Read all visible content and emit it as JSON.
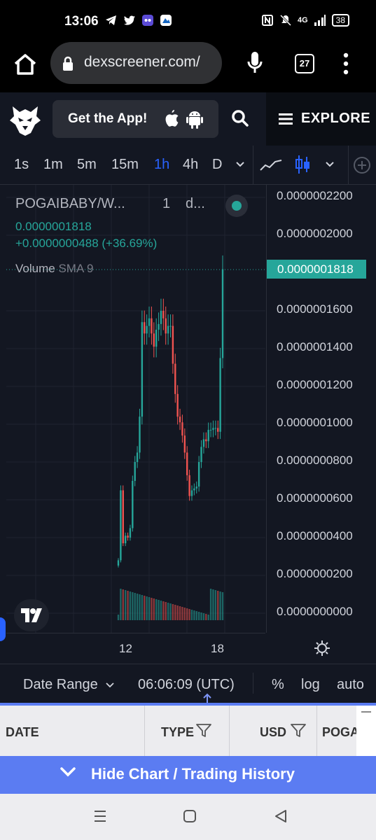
{
  "status_bar": {
    "time": "13:06",
    "network": "4G",
    "battery": "38"
  },
  "browser": {
    "url": "dexscreener.com/",
    "tab_count": "27"
  },
  "dex_header": {
    "get_app_label": "Get the App!",
    "explore_label": "EXPLORE"
  },
  "chart_toolbar": {
    "timeframes": [
      "1s",
      "1m",
      "5m",
      "15m",
      "1h",
      "4h",
      "D"
    ],
    "active_timeframe": "1h"
  },
  "legend": {
    "symbol": "POGAIBABY/W...",
    "interval": "1",
    "source": "d...",
    "price": "0.0000001818",
    "change": "+0.0000000488 (+36.69%)",
    "volume_label": "Volume",
    "volume_sma": "SMA 9"
  },
  "price_axis": {
    "ticks": [
      "0.0000002200",
      "0.0000002000",
      "0.0000001600",
      "0.0000001400",
      "0.0000001200",
      "0.0000001000",
      "0.0000000800",
      "0.0000000600",
      "0.0000000400",
      "0.0000000200",
      "0.0000000000"
    ],
    "last_price": "0.0000001818"
  },
  "time_axis": {
    "ticks": [
      "12",
      "18"
    ]
  },
  "bottom_bar": {
    "date_range": "Date Range",
    "clock": "06:06:09 (UTC)",
    "percent": "%",
    "log": "log",
    "auto": "auto"
  },
  "table_header": {
    "columns": [
      "DATE",
      "TYPE",
      "USD",
      "POGA"
    ]
  },
  "hide_chart_label": "Hide Chart / Trading History",
  "colors": {
    "up": "#26a69a",
    "down": "#ef5350",
    "accent": "#2962ff",
    "banner": "#5b7cf2"
  },
  "chart_data": {
    "type": "candlestick",
    "x_ticks": [
      "12",
      "18"
    ],
    "y_ticks": [
      2.2e-07,
      2e-07,
      1.6e-07,
      1.4e-07,
      1.2e-07,
      1e-07,
      8e-08,
      6e-08,
      4e-08,
      2e-08,
      0
    ],
    "ylim": [
      0,
      2.275e-07
    ],
    "last": 1.818e-07,
    "grid": true,
    "close_series": [
      2.8e-08,
      6.5e-08,
      3.7e-08,
      4.1e-08,
      4e-08,
      4.5e-08,
      7e-08,
      8e-08,
      8.5e-08,
      1.04e-07,
      1.54e-07,
      1.48e-07,
      1.52e-07,
      1.56e-07,
      1.48e-07,
      1.41e-07,
      1.5e-07,
      1.53e-07,
      1.6e-07,
      1.56e-07,
      1.48e-07,
      1.52e-07,
      1.52e-07,
      1.32e-07,
      1.16e-07,
      1.04e-07,
      1.01e-07,
      9.4e-08,
      8.5e-08,
      7.3e-08,
      6.2e-08,
      6.5e-08,
      6.6e-08,
      6.7e-08,
      8e-08,
      8.8e-08,
      9.2e-08,
      9.1e-08,
      9.7e-08,
      9.7e-08,
      9.8e-08,
      9.8e-08,
      9.6e-08,
      1.35e-07,
      1.82e-07
    ]
  }
}
